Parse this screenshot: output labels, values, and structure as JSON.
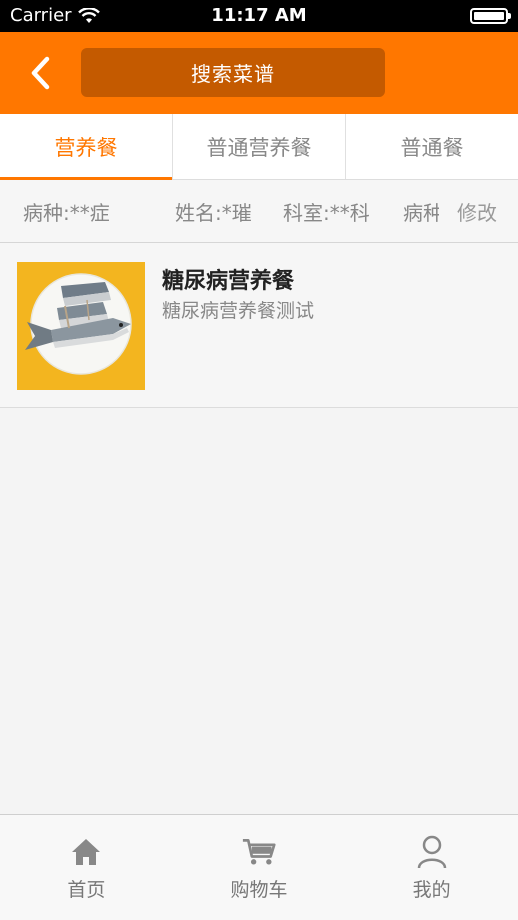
{
  "status_bar": {
    "carrier": "Carrier",
    "time": "11:17 AM"
  },
  "nav": {
    "search_label": "搜索菜谱",
    "accent_color": "#ff7700"
  },
  "tabs": [
    {
      "label": "营养餐",
      "active": true
    },
    {
      "label": "普通营养餐",
      "active": false
    },
    {
      "label": "普通餐",
      "active": false
    }
  ],
  "info_bar": {
    "disease": "病种:**症",
    "name": "姓名:*璀",
    "department": "科室:**科",
    "disease_truncated": "病种",
    "edit_label": "修改"
  },
  "items": [
    {
      "title": "糖尿病营养餐",
      "description": "糖尿病营养餐测试",
      "image": "fish-on-plate"
    }
  ],
  "tab_bar": [
    {
      "label": "首页",
      "icon": "home-icon"
    },
    {
      "label": "购物车",
      "icon": "cart-icon"
    },
    {
      "label": "我的",
      "icon": "user-icon"
    }
  ]
}
